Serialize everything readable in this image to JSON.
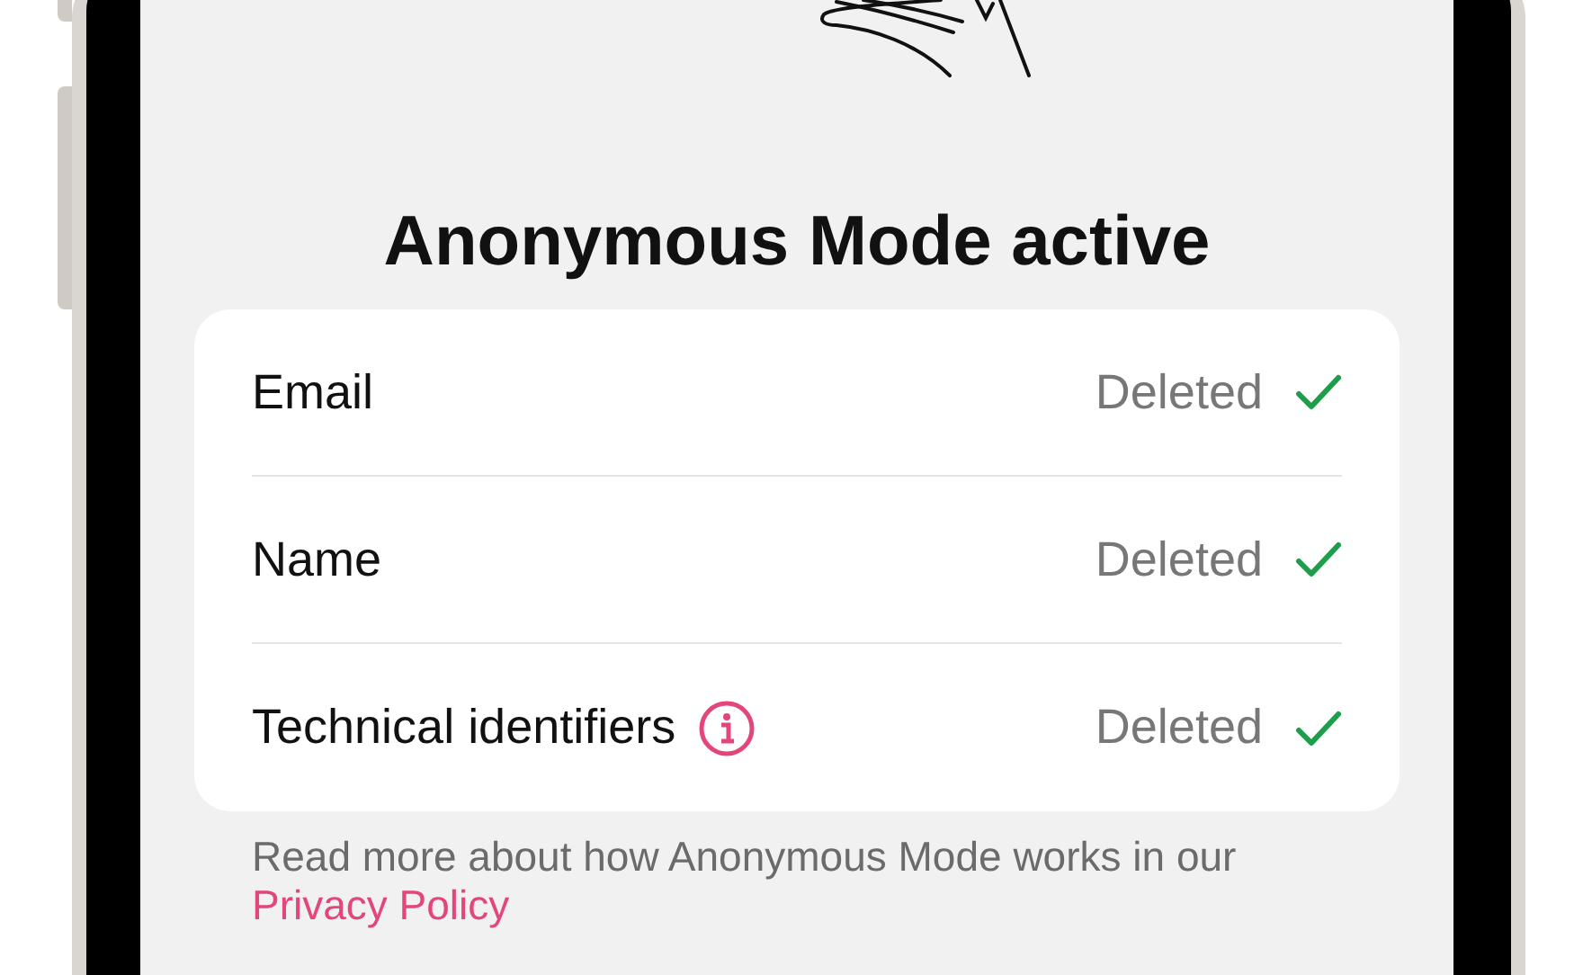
{
  "title": "Anonymous Mode active",
  "rows": [
    {
      "label": "Email",
      "info": false,
      "value": "Deleted",
      "checked": true
    },
    {
      "label": "Name",
      "info": false,
      "value": "Deleted",
      "checked": true
    },
    {
      "label": "Technical identifiers",
      "info": true,
      "value": "Deleted",
      "checked": true
    }
  ],
  "footer": {
    "text": "Read more about how Anonymous Mode works in our",
    "link": "Privacy Policy"
  }
}
